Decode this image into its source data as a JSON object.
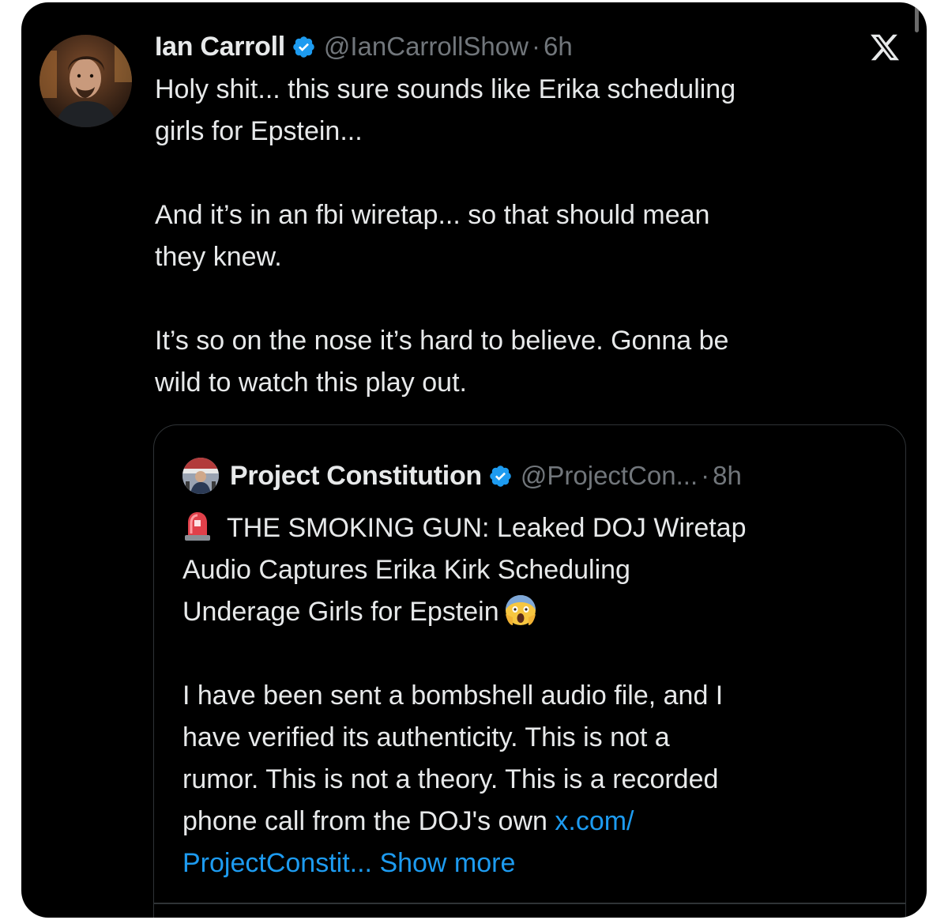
{
  "tweet": {
    "author_name": "Ian Carroll",
    "handle": "@IanCarrollShow",
    "separator": "·",
    "time": "6h",
    "text_lines": {
      "l1": "Holy shit... this sure sounds like Erika scheduling",
      "l2": "girls for Epstein...",
      "l3": "And it’s in an fbi wiretap... so that should mean",
      "l4": "they knew.",
      "l5": "It’s so on the nose it’s hard to believe. Gonna be",
      "l6": "wild to watch this play out."
    }
  },
  "quoted_tweet": {
    "author_name": "Project Constitution",
    "handle": "@ProjectCon...",
    "separator": "·",
    "time": "8h",
    "text_lines": {
      "l1": "THE SMOKING GUN: Leaked DOJ Wiretap",
      "l2": "Audio Captures Erika Kirk Scheduling",
      "l3": "Underage Girls for Epstein",
      "l4": "I have been sent a bombshell audio file, and I",
      "l5": "have verified its authenticity. This is not a",
      "l6": "rumor. This is not a theory. This is a recorded",
      "l7": "phone call from the DOJ's own "
    },
    "link_part1": "x.com/",
    "link_part2": "ProjectConstit...",
    "show_more": "Show more"
  },
  "icons": {
    "verified": "verified-badge-icon",
    "platform": "x-logo-icon",
    "siren": "rotating-light-emoji",
    "scream": "face-screaming-in-fear-emoji"
  },
  "colors": {
    "background": "#000000",
    "text_primary": "#e7e9ea",
    "text_secondary": "#71767b",
    "link": "#1d9bf0",
    "verified": "#1d9bf0",
    "border": "#2f3336"
  }
}
